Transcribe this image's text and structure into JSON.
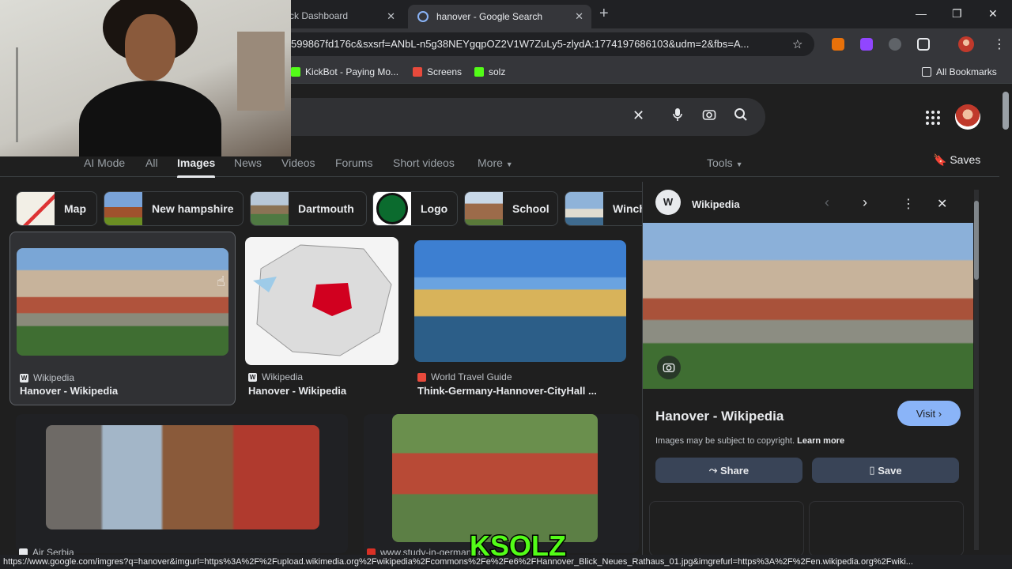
{
  "tabs": [
    {
      "label": "ck Dashboard",
      "close": "✕"
    },
    {
      "label": "hanover - Google Search",
      "close": "✕"
    }
  ],
  "new_tab": "+",
  "window_controls": {
    "minimize": "—",
    "restore": "❐",
    "close": "✕"
  },
  "address_bar": {
    "url": "599867fd176c&sxsrf=ANbL-n5g38NEYgqpOZ2V1W7ZuLy5-zlydA:1774197686103&udm=2&fbs=A..."
  },
  "bookmarks": [
    {
      "label": "KickBot - Paying Mo...",
      "icon": "kickbot-icon",
      "color": "#53fc18"
    },
    {
      "label": "Screens",
      "icon": "screens-icon",
      "color": "#e84a3c"
    },
    {
      "label": "solz",
      "icon": "kick-icon",
      "color": "#53fc18"
    }
  ],
  "all_bookmarks": "All Bookmarks",
  "nav_tabs": [
    "AI Mode",
    "All",
    "Images",
    "News",
    "Videos",
    "Forums",
    "Short videos",
    "More"
  ],
  "active_tab": "Images",
  "tools_label": "Tools",
  "saves_label": "Saves",
  "chips": [
    "Map",
    "New hampshire",
    "Dartmouth",
    "Logo",
    "School",
    "Winch"
  ],
  "results": [
    {
      "source": "Wikipedia",
      "title": "Hanover - Wikipedia"
    },
    {
      "source": "Wikipedia",
      "title": "Hanover - Wikipedia"
    },
    {
      "source": "World Travel Guide",
      "title": "Think-Germany-Hannover-CityHall ..."
    },
    {
      "source": "Air Serbia",
      "title": ""
    },
    {
      "source": "www.study-in-germany.de",
      "title": ""
    }
  ],
  "panel": {
    "source": "Wikipedia",
    "title": "Hanover - Wikipedia",
    "visit": "Visit",
    "copyright": "Images may be subject to copyright.",
    "learn_more": "Learn more",
    "share": "Share",
    "save": "Save"
  },
  "status_url": "https://www.google.com/imgres?q=hanover&imgurl=https%3A%2F%2Fupload.wikimedia.org%2Fwikipedia%2Fcommons%2Fe%2Fe6%2FHannover_Blick_Neues_Rathaus_01.jpg&imgrefurl=https%3A%2F%2Fen.wikipedia.org%2Fwiki...",
  "watermark": "KSOLZ",
  "colors": {
    "accent": "#8ab4f8",
    "kick_green": "#53fc18",
    "page_bg": "#1f1f1f",
    "button_bg": "#394457"
  }
}
